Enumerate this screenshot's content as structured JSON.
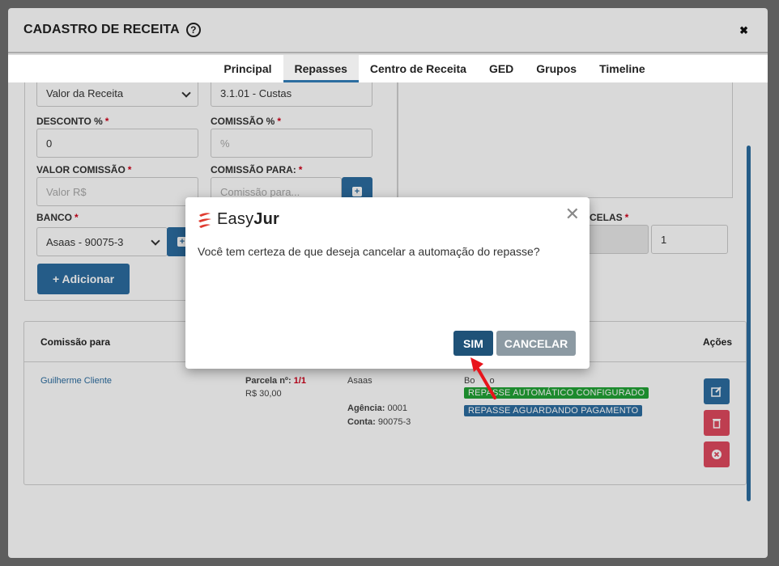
{
  "modal": {
    "title": "CADASTRO DE RECEITA",
    "tabs": [
      "Principal",
      "Repasses",
      "Centro de Receita",
      "GED",
      "Grupos",
      "Timeline"
    ]
  },
  "form": {
    "tipo_select": "Valor da Receita",
    "conta_input": "3.1.01 - Custas",
    "desconto_label": "DESCONTO %",
    "desconto_value": "0",
    "comissao_pct_label": "COMISSÃO %",
    "comissao_pct_placeholder": "%",
    "valor_comissao_label": "VALOR COMISSÃO",
    "valor_comissao_placeholder": "Valor R$",
    "comissao_para_label": "COMISSÃO PARA:",
    "comissao_para_placeholder": "Comissão para...",
    "banco_label": "BANCO",
    "banco_value": "Asaas - 90075-3",
    "parcelas_label_partial": "CELAS",
    "parcelas_value": "1",
    "add_button": "+ Adicionar",
    "required_mark": "*"
  },
  "table": {
    "col_comissao": "Comissão para",
    "col_acoes": "Ações",
    "row": {
      "cliente": "Guilherme Cliente",
      "parcela_label": "Parcela nº:",
      "parcela_value": "1/1",
      "valor": "R$ 30,00",
      "banco": "Asaas",
      "agencia_label": "Agência:",
      "agencia_value": "0001",
      "conta_label": "Conta:",
      "conta_value": "90075-3",
      "forma_partial": "Bo",
      "forma_trail": "o",
      "badge_auto": "REPASSE AUTOMÁTICO CONFIGURADO",
      "badge_aguardando": "REPASSE AGUARDANDO PAGAMENTO"
    }
  },
  "dialog": {
    "logo_easy": "Easy",
    "logo_jur": "Jur",
    "message": "Você tem certeza de que deseja cancelar a automação do repasse?",
    "confirm": "SIM",
    "cancel": "CANCELAR"
  },
  "colors": {
    "primary": "#2c6da0",
    "dark_primary": "#1f5278",
    "success": "#21a336",
    "danger": "#e0495e",
    "required": "#d0021b",
    "brand_red": "#e03a2f"
  }
}
